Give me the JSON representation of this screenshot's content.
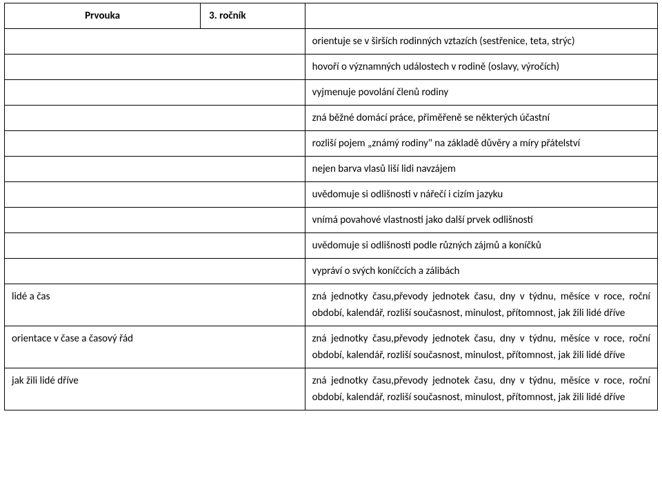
{
  "header": {
    "title": "Prvouka",
    "grade": "3. ročník"
  },
  "rows": [
    {
      "left": "",
      "right": "orientuje se v širších rodinných vztazích (sestřenice, teta, strýc)"
    },
    {
      "left": "",
      "right": "hovoří o významných událostech v rodině (oslavy, výročích)"
    },
    {
      "left": "",
      "right": "vyjmenuje povolání členů rodiny"
    },
    {
      "left": "",
      "right": "zná běžné domácí práce, přiměřeně se některých účastní"
    },
    {
      "left": "",
      "right": "rozliší pojem „známý rodiny\" na základě důvěry a míry přátelství"
    },
    {
      "left": "",
      "right": "nejen barva vlasů liší lidi navzájem"
    },
    {
      "left": "",
      "right": "uvědomuje si odlišnosti v nářečí i cizím jazyku"
    },
    {
      "left": "",
      "right": "vnímá povahové vlastnosti jako další prvek odlišností"
    },
    {
      "left": "",
      "right": "uvědomuje si odlišnosti podle různých zájmů a koníčků"
    },
    {
      "left": "",
      "right": "vypráví o svých koníčcích a zálibách"
    },
    {
      "left": "lidé a čas",
      "right": "zná jednotky času,převody jednotek času, dny v týdnu, měsíce v roce, roční období, kalendář, rozliší současnost, minulost, přítomnost, jak žili lidé dříve"
    },
    {
      "left": "orientace v čase a časový řád",
      "right": "zná jednotky času,převody jednotek času, dny v týdnu, měsíce v roce, roční období, kalendář, rozliší současnost, minulost, přítomnost, jak žili lidé dříve"
    },
    {
      "left": "jak žili lidé dříve",
      "right": "zná jednotky času,převody jednotek času, dny v týdnu, měsíce v roce, roční období, kalendář, rozliší současnost, minulost, přítomnost, jak žili lidé dříve"
    }
  ]
}
